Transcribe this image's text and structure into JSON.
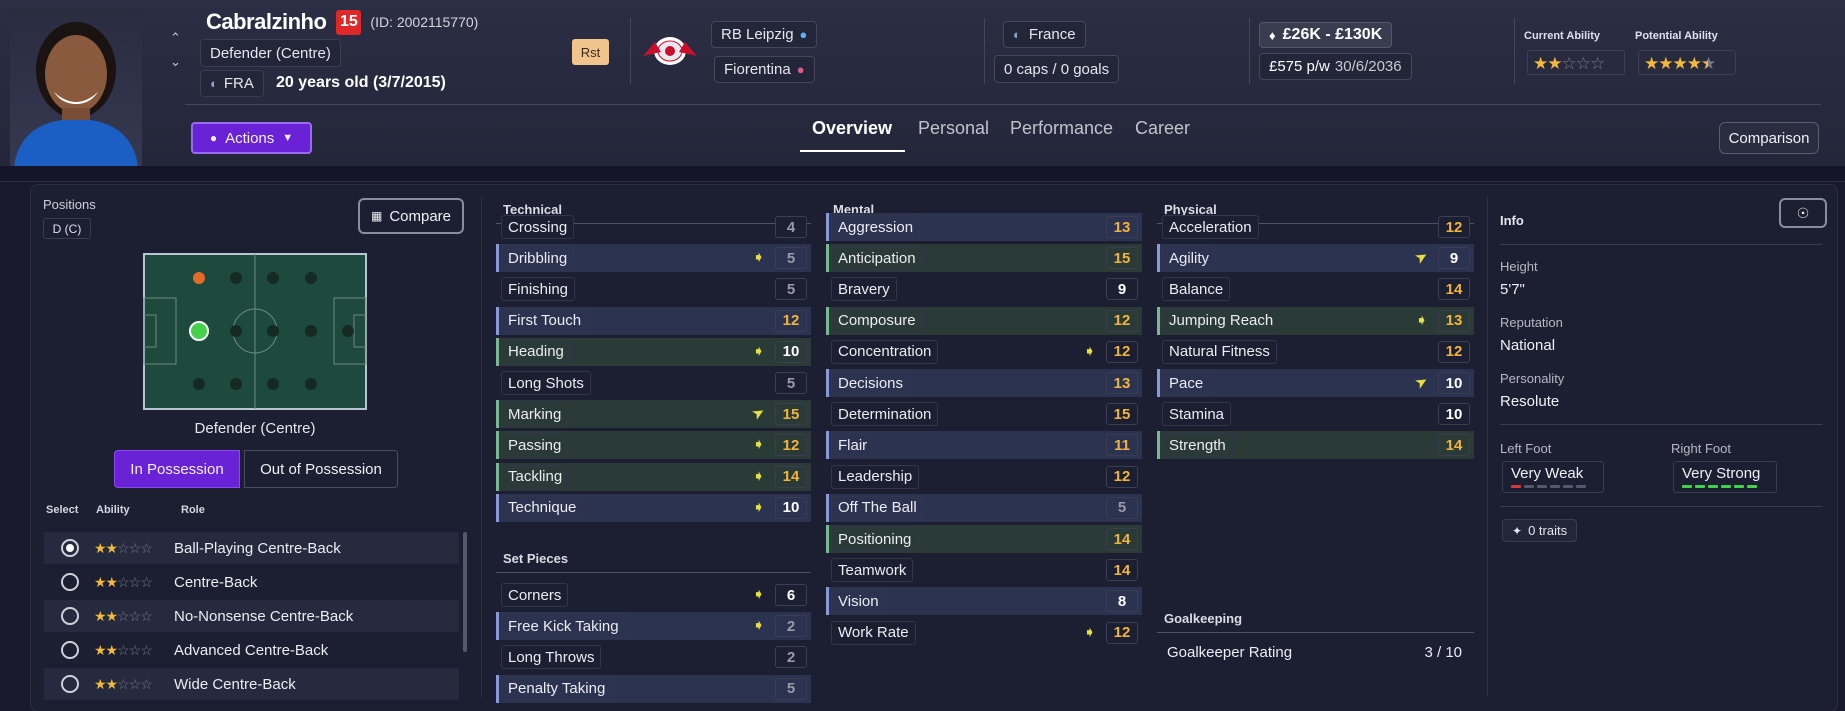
{
  "player": {
    "name": "Cabralzinho",
    "number": "15",
    "id_text": "(ID: 2002115770)",
    "position_text": "Defender (Centre)",
    "nationality_code": "FRA",
    "age_text": "20 years old (3/7/2015)",
    "role_tag": "Rst"
  },
  "clubs": {
    "parent": "RB Leipzig",
    "loan": "Fiorentina"
  },
  "national": {
    "country": "France",
    "caps": "0 caps / 0 goals"
  },
  "contract": {
    "value": "£26K - £130K",
    "wage": "£575 p/w",
    "expiry": "30/6/2036"
  },
  "ability": {
    "current_label": "Current Ability",
    "potential_label": "Potential Ability",
    "current_stars": 2,
    "potential_stars": 4.5
  },
  "actions_label": "Actions",
  "tabs": [
    "Overview",
    "Personal",
    "Performance",
    "Career"
  ],
  "comparison_label": "Comparison",
  "positions": {
    "title": "Positions",
    "badge": "D (C)",
    "compare_label": "Compare",
    "pitch_caption": "Defender (Centre)",
    "in_possession": "In Possession",
    "out_of_possession": "Out of Possession"
  },
  "roles_header": {
    "select": "Select",
    "ability": "Ability",
    "role": "Role"
  },
  "roles": [
    {
      "name": "Ball-Playing Centre-Back",
      "stars": 2,
      "selected": true
    },
    {
      "name": "Centre-Back",
      "stars": 2,
      "selected": false
    },
    {
      "name": "No-Nonsense Centre-Back",
      "stars": 2,
      "selected": false
    },
    {
      "name": "Advanced Centre-Back",
      "stars": 2,
      "selected": false
    },
    {
      "name": "Wide Centre-Back",
      "stars": 2,
      "selected": false
    }
  ],
  "sections": {
    "technical": "Technical",
    "set_pieces": "Set Pieces",
    "mental": "Mental",
    "physical": "Physical",
    "goalkeeping": "Goalkeeping"
  },
  "technical": [
    {
      "name": "Crossing",
      "value": "4",
      "trend": "",
      "hl": ""
    },
    {
      "name": "Dribbling",
      "value": "5",
      "trend": "down",
      "hl": "blue"
    },
    {
      "name": "Finishing",
      "value": "5",
      "trend": "",
      "hl": ""
    },
    {
      "name": "First Touch",
      "value": "12",
      "trend": "",
      "hl": "blue"
    },
    {
      "name": "Heading",
      "value": "10",
      "trend": "down",
      "hl": "green"
    },
    {
      "name": "Long Shots",
      "value": "5",
      "trend": "",
      "hl": ""
    },
    {
      "name": "Marking",
      "value": "15",
      "trend": "up",
      "hl": "green"
    },
    {
      "name": "Passing",
      "value": "12",
      "trend": "down",
      "hl": "green"
    },
    {
      "name": "Tackling",
      "value": "14",
      "trend": "down",
      "hl": "green"
    },
    {
      "name": "Technique",
      "value": "10",
      "trend": "down",
      "hl": "blue"
    }
  ],
  "set_pieces": [
    {
      "name": "Corners",
      "value": "6",
      "trend": "down",
      "hl": ""
    },
    {
      "name": "Free Kick Taking",
      "value": "2",
      "trend": "down",
      "hl": "blue"
    },
    {
      "name": "Long Throws",
      "value": "2",
      "trend": "",
      "hl": ""
    },
    {
      "name": "Penalty Taking",
      "value": "5",
      "trend": "",
      "hl": "blue"
    }
  ],
  "mental": [
    {
      "name": "Aggression",
      "value": "13",
      "trend": "",
      "hl": "blue"
    },
    {
      "name": "Anticipation",
      "value": "15",
      "trend": "",
      "hl": "green"
    },
    {
      "name": "Bravery",
      "value": "9",
      "trend": "",
      "hl": ""
    },
    {
      "name": "Composure",
      "value": "12",
      "trend": "",
      "hl": "green"
    },
    {
      "name": "Concentration",
      "value": "12",
      "trend": "down",
      "hl": ""
    },
    {
      "name": "Decisions",
      "value": "13",
      "trend": "",
      "hl": "blue"
    },
    {
      "name": "Determination",
      "value": "15",
      "trend": "",
      "hl": ""
    },
    {
      "name": "Flair",
      "value": "11",
      "trend": "",
      "hl": "blue"
    },
    {
      "name": "Leadership",
      "value": "12",
      "trend": "",
      "hl": ""
    },
    {
      "name": "Off The Ball",
      "value": "5",
      "trend": "",
      "hl": "blue"
    },
    {
      "name": "Positioning",
      "value": "14",
      "trend": "",
      "hl": "green"
    },
    {
      "name": "Teamwork",
      "value": "14",
      "trend": "",
      "hl": ""
    },
    {
      "name": "Vision",
      "value": "8",
      "trend": "",
      "hl": "blue"
    },
    {
      "name": "Work Rate",
      "value": "12",
      "trend": "down",
      "hl": ""
    }
  ],
  "physical": [
    {
      "name": "Acceleration",
      "value": "12",
      "trend": "",
      "hl": ""
    },
    {
      "name": "Agility",
      "value": "9",
      "trend": "up",
      "hl": "blue"
    },
    {
      "name": "Balance",
      "value": "14",
      "trend": "",
      "hl": ""
    },
    {
      "name": "Jumping Reach",
      "value": "13",
      "trend": "down",
      "hl": "green"
    },
    {
      "name": "Natural Fitness",
      "value": "12",
      "trend": "",
      "hl": ""
    },
    {
      "name": "Pace",
      "value": "10",
      "trend": "up",
      "hl": "blue"
    },
    {
      "name": "Stamina",
      "value": "10",
      "trend": "",
      "hl": ""
    },
    {
      "name": "Strength",
      "value": "14",
      "trend": "",
      "hl": "green"
    }
  ],
  "goalkeeping": {
    "label": "Goalkeeper Rating",
    "value": "3 / 10"
  },
  "info": {
    "title": "Info",
    "height_label": "Height",
    "height": "5'7\"",
    "reputation_label": "Reputation",
    "reputation": "National",
    "personality_label": "Personality",
    "personality": "Resolute",
    "left_foot_label": "Left Foot",
    "left_foot": "Very Weak",
    "left_foot_level": 1,
    "right_foot_label": "Right Foot",
    "right_foot": "Very Strong",
    "right_foot_level": 6,
    "traits": "0 traits"
  },
  "colors": {
    "accent": "#6a22d6",
    "green_hl": "#2a3a36",
    "blue_hl": "#2c3350",
    "value_high": "#f2b43a",
    "value_low": "#9a9aa8",
    "pitch": "#1d4a3c",
    "foot_red": "#d23b3b",
    "foot_green": "#3fd24a"
  }
}
